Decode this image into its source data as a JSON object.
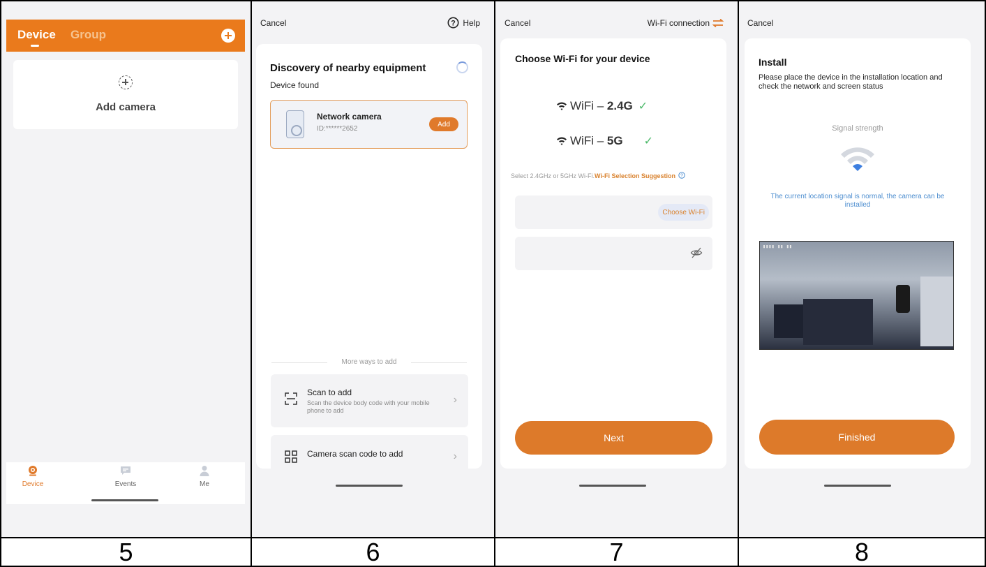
{
  "panel5": {
    "tabs": [
      "Device",
      "Group"
    ],
    "add_camera_label": "Add camera",
    "nav": [
      {
        "label": "Device",
        "icon": "camera-icon",
        "active": true
      },
      {
        "label": "Events",
        "icon": "message-icon",
        "active": false
      },
      {
        "label": "Me",
        "icon": "person-icon",
        "active": false
      }
    ]
  },
  "panel6": {
    "cancel": "Cancel",
    "help": "Help",
    "title": "Discovery of nearby equipment",
    "found": "Device found",
    "device": {
      "name": "Network camera",
      "id": "ID:******2652",
      "add": "Add"
    },
    "more_ways": "More ways to add",
    "options": [
      {
        "title": "Scan to add",
        "subtitle": "Scan the device body code with your mobile phone to add"
      },
      {
        "title": "Camera scan code to add",
        "subtitle": ""
      }
    ]
  },
  "panel7": {
    "cancel": "Cancel",
    "wifi_connection": "Wi-Fi connection",
    "title": "Choose Wi-Fi for your device",
    "bands": [
      {
        "prefix": "WiFi – ",
        "band": "2.4G"
      },
      {
        "prefix": "WiFi – ",
        "band": "5G"
      }
    ],
    "hint": "Select 2.4GHz or 5GHz Wi-Fi.",
    "hint_link": "Wi-Fi Selection Suggestion",
    "choose_wifi": "Choose Wi-Fi",
    "next": "Next"
  },
  "panel8": {
    "cancel": "Cancel",
    "title": "Install",
    "description": "Please place the device in the installation location and check the network and screen status",
    "signal_label": "Signal strength",
    "message": "The current location signal is normal, the camera can be installed",
    "finished": "Finished"
  },
  "step_labels": [
    "5",
    "6",
    "7",
    "8"
  ],
  "colors": {
    "accent": "#dd7a2a",
    "header": "#ea7a1c",
    "check": "#4ab868",
    "link_blue": "#4f8fd0"
  }
}
